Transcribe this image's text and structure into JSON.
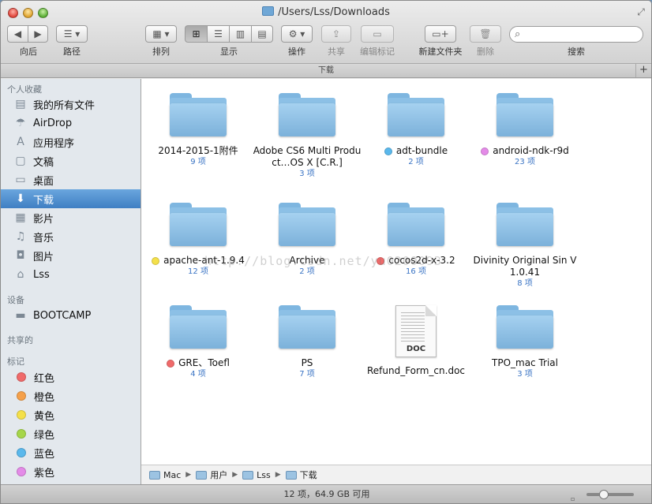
{
  "window": {
    "title": "/Users/Lss/Downloads"
  },
  "toolbar": {
    "back_label": "向后",
    "path_label": "路径",
    "arrange_label": "排列",
    "view_label": "显示",
    "action_label": "操作",
    "share_label": "共享",
    "edit_tags_label": "编辑标记",
    "new_folder_label": "新建文件夹",
    "delete_label": "删除",
    "search_label": "搜索",
    "search_placeholder": ""
  },
  "pathbar": {
    "title": "下载"
  },
  "sidebar": {
    "favorites_header": "个人收藏",
    "favorites": [
      {
        "label": "我的所有文件",
        "icon": "all-files-icon"
      },
      {
        "label": "AirDrop",
        "icon": "airdrop-icon"
      },
      {
        "label": "应用程序",
        "icon": "applications-icon"
      },
      {
        "label": "文稿",
        "icon": "documents-icon"
      },
      {
        "label": "桌面",
        "icon": "desktop-icon"
      },
      {
        "label": "下载",
        "icon": "downloads-icon"
      },
      {
        "label": "影片",
        "icon": "movies-icon"
      },
      {
        "label": "音乐",
        "icon": "music-icon"
      },
      {
        "label": "图片",
        "icon": "pictures-icon"
      },
      {
        "label": "Lss",
        "icon": "home-icon"
      }
    ],
    "devices_header": "设备",
    "devices": [
      {
        "label": "BOOTCAMP",
        "icon": "disk-icon"
      }
    ],
    "shared_header": "共享的",
    "tags_header": "标记",
    "tags": [
      {
        "label": "红色",
        "color": "#f06a6a"
      },
      {
        "label": "橙色",
        "color": "#f5a04a"
      },
      {
        "label": "黄色",
        "color": "#f4e04a"
      },
      {
        "label": "绿色",
        "color": "#a6d64a"
      },
      {
        "label": "蓝色",
        "color": "#5ab8ec"
      },
      {
        "label": "紫色",
        "color": "#e48be8"
      }
    ]
  },
  "files": [
    {
      "name": "2014-2015-1附件",
      "count": "9 项",
      "type": "folder",
      "tag": ""
    },
    {
      "name": "Adobe CS6 Multi Product…OS X [C.R.]",
      "count": "3 项",
      "type": "folder",
      "tag": ""
    },
    {
      "name": "adt-bundle",
      "count": "2 项",
      "type": "folder",
      "tag": "#5ab8ec"
    },
    {
      "name": "android-ndk-r9d",
      "count": "23 项",
      "type": "folder",
      "tag": "#e48be8"
    },
    {
      "name": "apache-ant-1.9.4",
      "count": "12 项",
      "type": "folder",
      "tag": "#f4e04a"
    },
    {
      "name": "Archive",
      "count": "2 项",
      "type": "folder",
      "tag": ""
    },
    {
      "name": "cocos2d-x-3.2",
      "count": "16 项",
      "type": "folder",
      "tag": "#f06a6a"
    },
    {
      "name": "Divinity Original Sin V1.0.41",
      "count": "8 项",
      "type": "folder",
      "tag": ""
    },
    {
      "name": "GRE、Toefl",
      "count": "4 项",
      "type": "folder",
      "tag": "#f06a6a"
    },
    {
      "name": "PS",
      "count": "7 项",
      "type": "folder",
      "tag": ""
    },
    {
      "name": "Refund_Form_cn.doc",
      "count": "",
      "type": "doc",
      "doc_label": "DOC",
      "tag": ""
    },
    {
      "name": "TPO_mac Trial",
      "count": "3 项",
      "type": "folder",
      "tag": ""
    }
  ],
  "watermark": "http://blog.csdn.net/yu0200093",
  "bottom_path": [
    "Mac",
    "用户",
    "Lss",
    "下载"
  ],
  "status": {
    "text": "12 项，64.9 GB 可用"
  }
}
